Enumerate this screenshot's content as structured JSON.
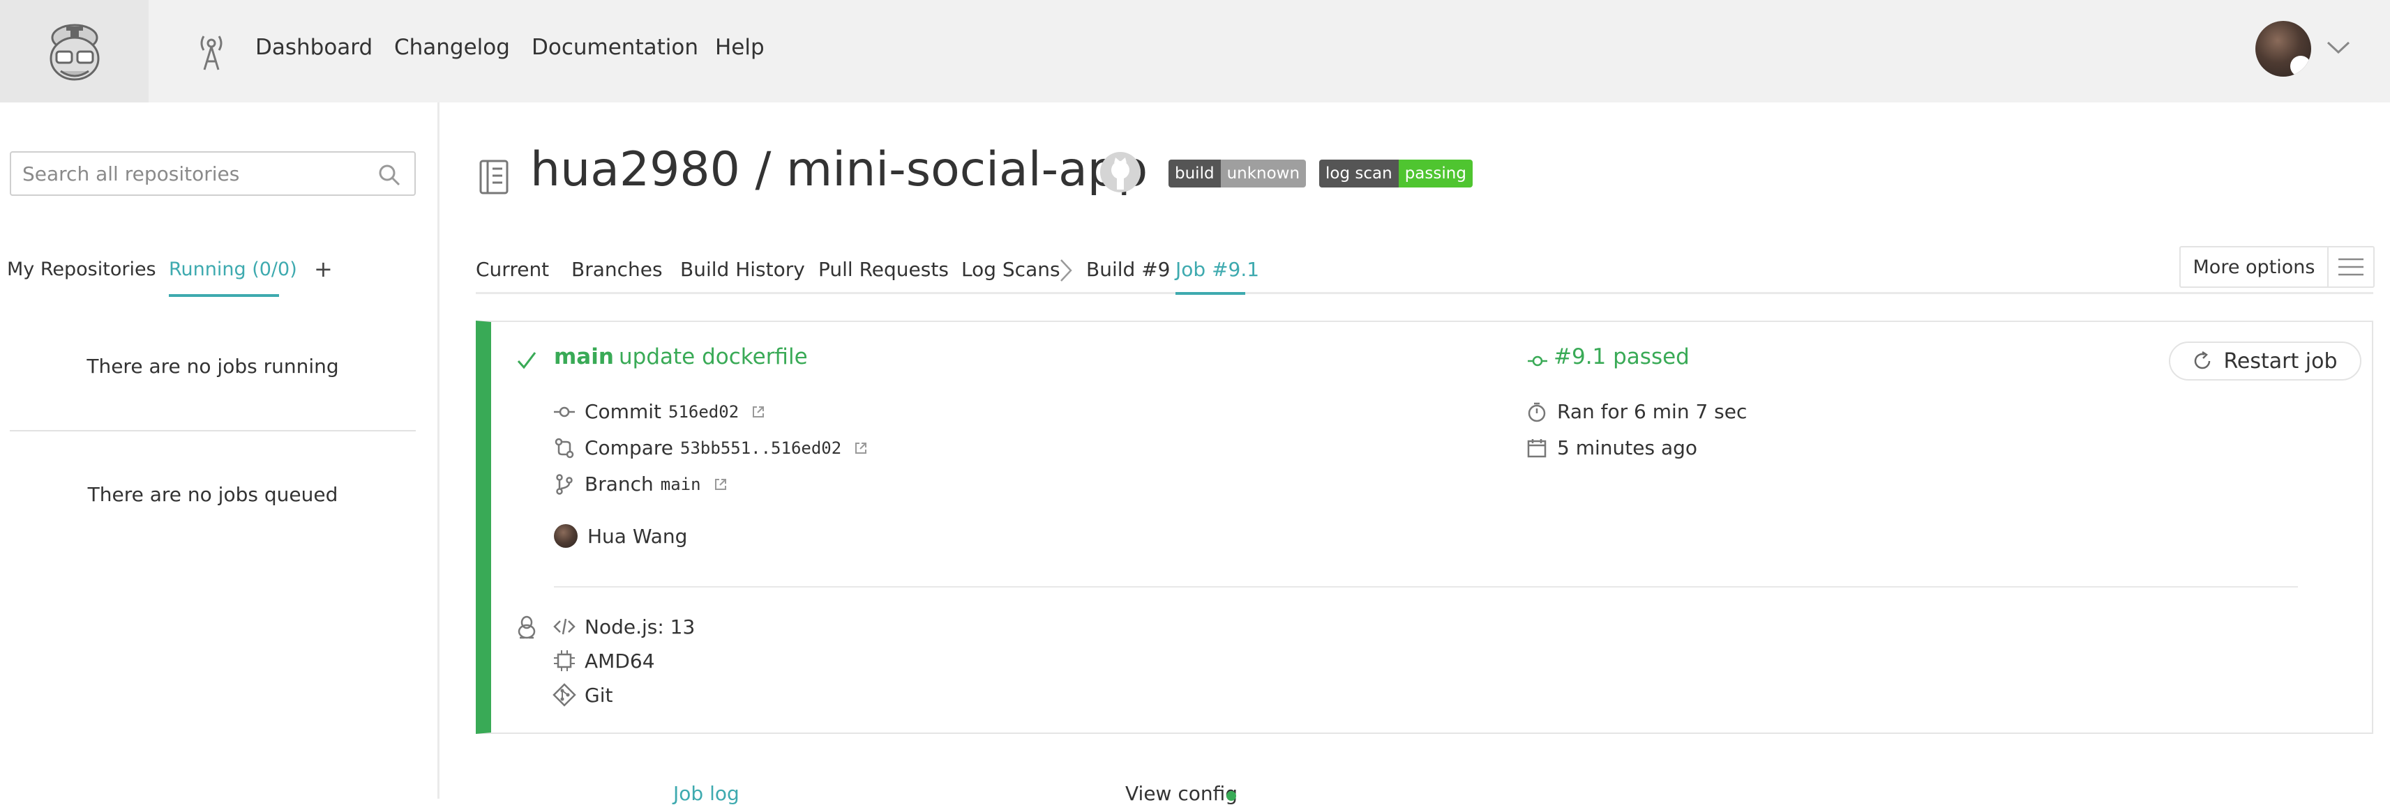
{
  "topbar": {
    "nav": [
      "Dashboard",
      "Changelog",
      "Documentation",
      "Help"
    ]
  },
  "sidebar": {
    "search_placeholder": "Search all repositories",
    "tabs": {
      "my_repos": "My Repositories",
      "running": "Running (0/0)",
      "add": "+"
    },
    "no_jobs_running": "There are no jobs running",
    "no_jobs_queued": "There are no jobs queued"
  },
  "repo": {
    "title": "hua2980 / mini-social-app",
    "badges": [
      {
        "label": "build",
        "status": "unknown",
        "color": "#9f9f9f"
      },
      {
        "label": "log scan",
        "status": "passing",
        "color": "#4fc530"
      }
    ]
  },
  "tabs": {
    "items": [
      "Current",
      "Branches",
      "Build History",
      "Pull Requests",
      "Log Scans",
      "Build #9",
      "Job #9.1"
    ],
    "active": "Job #9.1",
    "more_options": "More options"
  },
  "job": {
    "branch": "main",
    "message": "update dockerfile",
    "number_status": "#9.1 passed",
    "restart_label": "Restart job",
    "commit_label": "Commit",
    "commit_sha": "516ed02",
    "compare_label": "Compare",
    "compare_range": "53bb551..516ed02",
    "branch_label": "Branch",
    "branch_value": "main",
    "author": "Hua Wang",
    "duration": "Ran for 6 min 7 sec",
    "finished": "5 minutes ago",
    "language": "Node.js: 13",
    "arch": "AMD64",
    "vcs": "Git",
    "status_color": "#39aa56"
  },
  "bottom": {
    "job_log": "Job log",
    "view_config": "View config"
  },
  "colors": {
    "accent": "#3eaaaf",
    "passed": "#39aa56"
  }
}
